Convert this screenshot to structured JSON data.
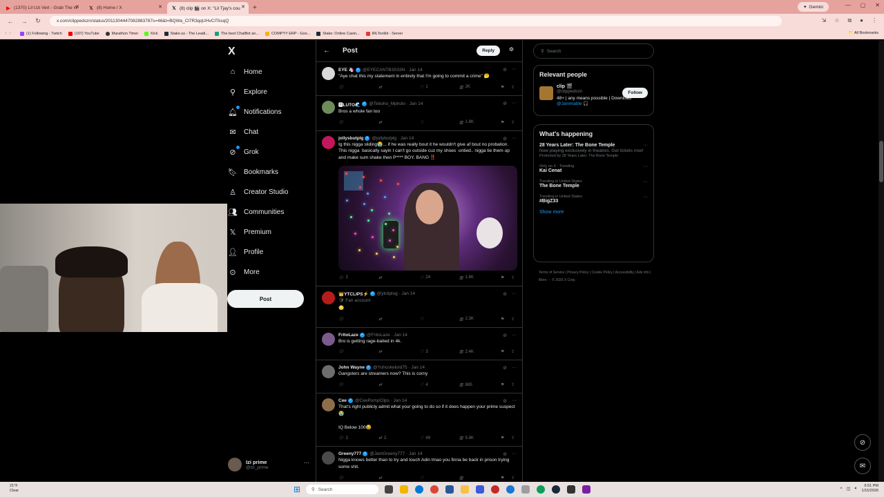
{
  "browser": {
    "tabs": [
      {
        "title": "(1370) Lil Uzi Vert - Grab The W",
        "icon": "youtube-icon"
      },
      {
        "title": "(8) Home / X",
        "icon": "x-icon"
      },
      {
        "title": "(8) clip 🎬 on X: \"Lil Tjay's cou",
        "icon": "x-icon",
        "active": true
      }
    ],
    "new_tab": "+",
    "gemini": "Gemini",
    "url": "x.com/clippedszn/status/2011304447082883787s=46&t=BQWa_Cl7R3qqUHvCITksqQ",
    "bookmarks": [
      "(1) Following - Twitch",
      "(107) YouTube",
      "Marathon Timer",
      "Kick",
      "Stake.us - The Leadi...",
      "The best ChatBot an...",
      "COMPYY ERP - Goo...",
      "Stake: Online Casin...",
      "IRLToolkit - Server"
    ],
    "all_bookmarks": "All Bookmarks"
  },
  "sidebar": {
    "logo": "X",
    "items": [
      "Home",
      "Explore",
      "Notifications",
      "Chat",
      "Grok",
      "Bookmarks",
      "Creator Studio",
      "Communities",
      "Premium",
      "Profile",
      "More"
    ],
    "post_button": "Post",
    "account": {
      "name": "Izi prime",
      "handle": "@izi_prime",
      "more": "···"
    }
  },
  "column": {
    "back": "←",
    "title": "Post",
    "reply_button": "Reply",
    "tweets": [
      {
        "name": "EYE 🦄",
        "handle": "@EYECANTB3S33N · Jan 14",
        "text": "\"Aye chat this my statement in entirely that I'm going to commit a crime\" 🤔",
        "comments": "",
        "retweets": "",
        "likes": "1",
        "views": "2K",
        "avatar": "#d9d9d9"
      },
      {
        "name": "🅿LUTO🌊",
        "handle": "@Teboho_Mpholo · Jan 14",
        "text": "Bros a whole fan too",
        "comments": "",
        "retweets": "",
        "likes": "",
        "views": "1.8K",
        "avatar": "#6e8b5a"
      },
      {
        "name": "jollysbutplg",
        "handle": "@jollybutplg · Jan 14",
        "text": "Ig this nigga sliding😭... if he was really bout it he wouldn't give af bout no probation. This nigga  basically sayin I can't go outside cuz my shoes  untied.. nigga tie them up and make sum shake then P**** BOY. BANG ‼️",
        "comments": "2",
        "retweets": "",
        "likes": "24",
        "views": "1.6K",
        "avatar": "#c2185b",
        "media": true
      },
      {
        "name": "👑YTCLIPS⚡",
        "handle": "@ytcliplug · Jan 14",
        "sub": "🛡 Fan account",
        "text": "😳",
        "comments": "",
        "retweets": "",
        "likes": "",
        "views": "2.3K",
        "avatar": "#b71c1c"
      },
      {
        "name": "FritoLaze",
        "handle": "@FritoLaze · Jan 14",
        "text": "Bro is getting rage-baited in 4k.",
        "comments": "",
        "retweets": "",
        "likes": "3",
        "views": "2.4K",
        "avatar": "#7b5a8c"
      },
      {
        "name": "John Wayne",
        "handle": "@Yuhcokelord75 · Jan 14",
        "text": "Gangsters are streamers now? This is corny",
        "comments": "",
        "retweets": "",
        "likes": "4",
        "views": "885",
        "avatar": "#6d6d6d"
      },
      {
        "name": "Cee",
        "handle": "@CeePumpClips · Jan 14",
        "text": "That's right publicly admit what your going to do so if it does happen your prime suspect😭\n\nIQ Below 100😂",
        "comments": "2",
        "retweets": "2",
        "likes": "49",
        "views": "5.9K",
        "avatar": "#8d6e4a"
      },
      {
        "name": "Greeny777",
        "handle": "@JamGreeny777 · Jan 14",
        "text": "Nigga knows better than to try and touch Adin lmao you finna be back in prison trying some shit.",
        "comments": "",
        "retweets": "",
        "likes": "",
        "views": "",
        "avatar": "#4a4a4a"
      }
    ]
  },
  "right": {
    "search_placeholder": "Search",
    "relevant_title": "Relevant people",
    "person": {
      "name": "clip 🎬",
      "handle": "@clippedszn",
      "bio": "48+ | any means possible | Download",
      "link": "@Jammable 🎧",
      "follow": "Follow"
    },
    "happening_title": "What's happening",
    "trends": [
      {
        "name": "28 Years Later: The Bone Temple",
        "desc": "Now playing exclusively in theatres. Get tickets now!",
        "ctx": "Promoted by 28 Years Later: The Bone Temple"
      },
      {
        "ctx": "Only on X · Trending",
        "name": "Kai Cenat"
      },
      {
        "ctx": "Trending in United States",
        "name": "The Bone Temple"
      },
      {
        "ctx": "Trending in United States",
        "name": "#BigZ33"
      }
    ],
    "show_more": "Show more",
    "footer": "Terms of Service  |  Privacy Policy  |  Cookie Policy  |  Accessibility  |  Ads info  |  More ···  © 2026 X Corp."
  },
  "taskbar": {
    "weather_temp": "21°F",
    "weather_desc": "Clear",
    "search": "Search",
    "time": "6:51 PM",
    "date": "1/15/2026"
  },
  "colors": {
    "accent": "#1d9bf0",
    "bg": "#000000",
    "border": "#2f3336",
    "muted": "#71767b"
  }
}
